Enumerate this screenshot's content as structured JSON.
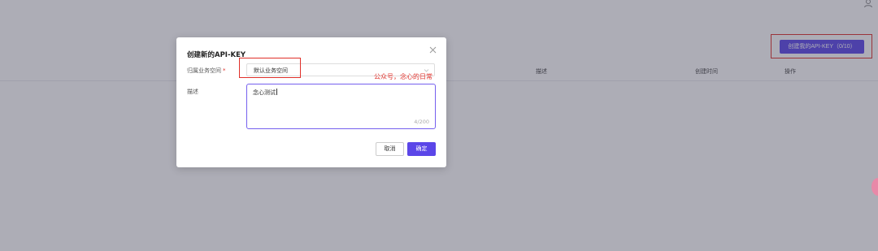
{
  "header": {
    "create_button_label": "创建我的API-KEY（0/10）",
    "user_icon": "user-icon"
  },
  "table": {
    "columns": [
      "描述",
      "创建时间",
      "操作"
    ]
  },
  "dialog": {
    "title": "创建新的API-KEY",
    "workspace_label": "归属业务空间",
    "workspace_required": "*",
    "workspace_value": "默认业务空间",
    "description_label": "描述",
    "description_value": "念心测试",
    "char_counter": "4/200",
    "cancel_label": "取消",
    "ok_label": "确定"
  },
  "annotation": {
    "watermark_text": "公众号，念心的日常"
  },
  "colors": {
    "primary": "#5b46e8",
    "highlight": "#e0302a",
    "overlay": "rgba(60,60,80,0.42)"
  }
}
